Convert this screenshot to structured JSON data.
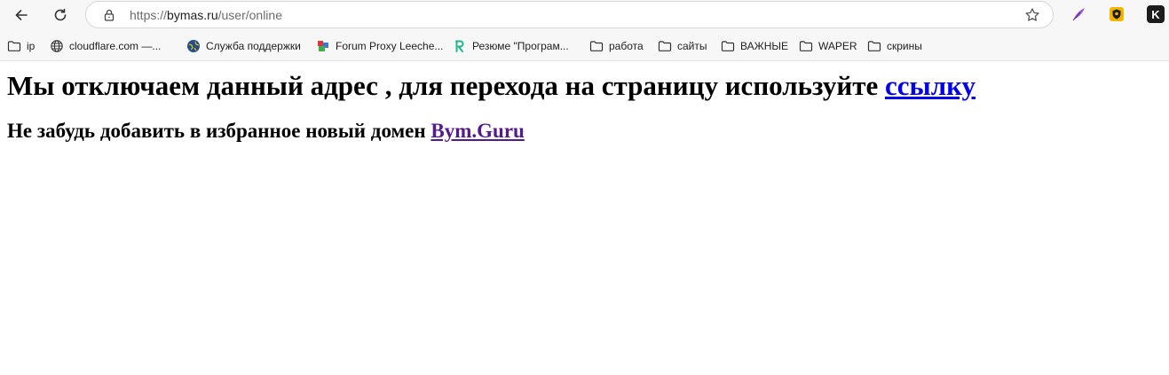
{
  "browser": {
    "url_scheme": "https://",
    "url_host": "bymas.ru",
    "url_path": "/user/online",
    "extension_k_label": "K"
  },
  "bookmarks": [
    {
      "label": "ip",
      "icon": "folder-icon"
    },
    {
      "label": "cloudflare.com —...",
      "icon": "globe-icon"
    },
    {
      "label": "Служба поддержки",
      "icon": "support-globe-icon"
    },
    {
      "label": "Forum Proxy Leeche...",
      "icon": "proxy-leecher-icon"
    },
    {
      "label": "Резюме \"Програм...",
      "icon": "r-logo-icon"
    },
    {
      "label": "работа",
      "icon": "folder-icon"
    },
    {
      "label": "сайты",
      "icon": "folder-icon"
    },
    {
      "label": "ВАЖНЫЕ",
      "icon": "folder-icon"
    },
    {
      "label": "WAPER",
      "icon": "folder-icon"
    },
    {
      "label": "скрины",
      "icon": "folder-icon"
    }
  ],
  "page": {
    "heading_text": "Мы отключаем данный адрес , для перехода на страницу используйте ",
    "heading_link": "ссылку",
    "subheading_text": "Не забудь добавить в избранное новый домен ",
    "subheading_link": "Bym.Guru"
  },
  "colors": {
    "link": "#0000ee",
    "visited_link": "#551a8b",
    "chrome_bg": "#f7f7f7"
  }
}
